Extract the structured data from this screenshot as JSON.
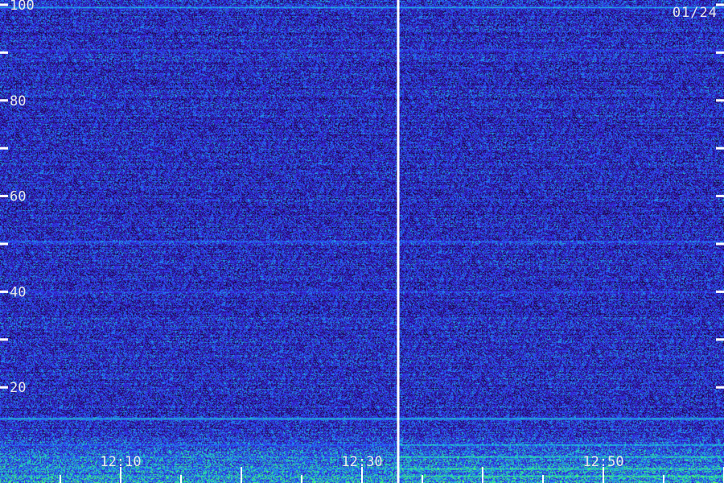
{
  "chart_data": {
    "type": "heatmap",
    "title": "",
    "date_label": "01/24",
    "xlabel": "",
    "ylabel": "",
    "x_start": "12:00",
    "x_end": "13:00",
    "x_tick_labels": [
      "12:10",
      "12:30",
      "12:50"
    ],
    "x_major_ticks": [
      "12:10",
      "12:20",
      "12:30",
      "12:40",
      "12:50",
      "13:00"
    ],
    "x_minor_ticks": [
      "12:05",
      "12:15",
      "12:25",
      "12:35",
      "12:45",
      "12:55"
    ],
    "ylim": [
      0,
      101
    ],
    "y_tick_labels": [
      20,
      40,
      60,
      80,
      100
    ],
    "y_minor_ticks": [
      30,
      50,
      70,
      90
    ],
    "marker_time": "12:33",
    "grid": false,
    "colormap": [
      "#000000",
      "#2a0a6e",
      "#3a1ccc",
      "#2450ff",
      "#20c8d0",
      "#40ff60",
      "#f0ff40"
    ],
    "background_level": 0.35,
    "bands": [
      {
        "y": 99.5,
        "intensity": 0.65
      },
      {
        "y": 50.5,
        "intensity": 0.5
      },
      {
        "y": 90.5,
        "intensity": 0.42
      },
      {
        "y": 40.0,
        "intensity": 0.42
      },
      {
        "y": 13.5,
        "intensity": 0.75
      },
      {
        "y": 8.0,
        "intensity": 0.85
      },
      {
        "y": 5.5,
        "intensity": 0.9
      },
      {
        "y": 3.0,
        "intensity": 0.95
      },
      {
        "y": 1.5,
        "intensity": 0.9
      }
    ]
  },
  "colors": {
    "axis": "#ffffff",
    "label": "#e8e8e8"
  }
}
